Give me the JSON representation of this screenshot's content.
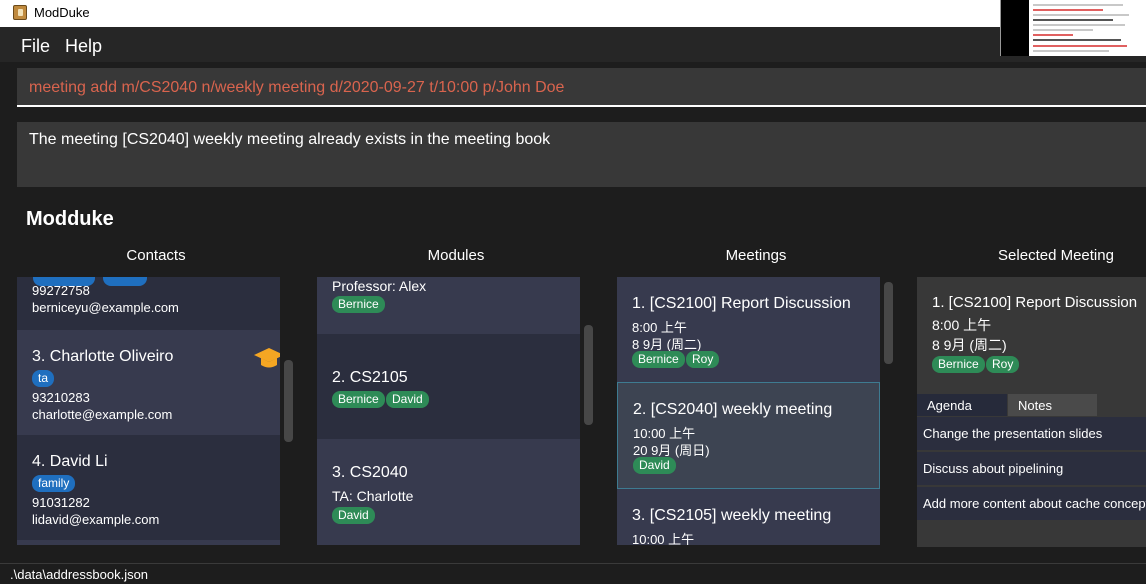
{
  "window": {
    "title": "ModDuke"
  },
  "menu": {
    "file": "File",
    "help": "Help"
  },
  "command": {
    "value": "meeting add m/CS2040 n/weekly meeting d/2020-09-27 t/10:00 p/John Doe"
  },
  "result": {
    "message": "The meeting [CS2040] weekly meeting already exists in the meeting book"
  },
  "app_title": "Modduke",
  "columns": {
    "contacts": "Contacts",
    "modules": "Modules",
    "meetings": "Meetings",
    "selected_meeting": "Selected Meeting"
  },
  "contacts": [
    {
      "name": "",
      "tags": [],
      "phone": "99272758",
      "email": "berniceyu@example.com"
    },
    {
      "name": "3.  Charlotte Oliveiro",
      "tags": [
        "ta"
      ],
      "phone": "93210283",
      "email": "charlotte@example.com",
      "icon": "graduation-cap-icon"
    },
    {
      "name": "4.  David Li",
      "tags": [
        "family"
      ],
      "phone": "91031282",
      "email": "lidavid@example.com"
    }
  ],
  "modules": [
    {
      "name": "",
      "role": "Professor: Alex",
      "tags": [
        "Bernice"
      ]
    },
    {
      "name": "2.  CS2105",
      "role": "",
      "tags": [
        "Bernice",
        "David"
      ]
    },
    {
      "name": "3.  CS2040",
      "role": "TA: Charlotte",
      "tags": [
        "David"
      ]
    }
  ],
  "meetings": [
    {
      "name": "1.  [CS2100] Report Discussion",
      "time": "8:00 上午",
      "date": "8 9月 (周二)",
      "tags": [
        "Bernice",
        "Roy"
      ]
    },
    {
      "name": "2.  [CS2040] weekly meeting",
      "time": "10:00 上午",
      "date": "20 9月 (周日)",
      "tags": [
        "David"
      ]
    },
    {
      "name": "3.  [CS2105] weekly meeting",
      "time": "10:00 上午",
      "date": "",
      "tags": []
    }
  ],
  "selected_meeting": {
    "name": "1.  [CS2100] Report Discussion",
    "time": "8:00 上午",
    "date": "8 9月 (周二)",
    "tags": [
      "Bernice",
      "Roy"
    ],
    "tabs": [
      "Agenda",
      "Notes"
    ],
    "agenda": [
      "Change the presentation slides",
      "Discuss about pipelining",
      "Add more content about cache concepts"
    ]
  },
  "status": {
    "path": ".\\data\\addressbook.json"
  },
  "colors": {
    "command_text": "#d9644e",
    "tag_blue": "#1f6fbf",
    "tag_green": "#2e8b57",
    "selected_border": "#3e7b91"
  }
}
